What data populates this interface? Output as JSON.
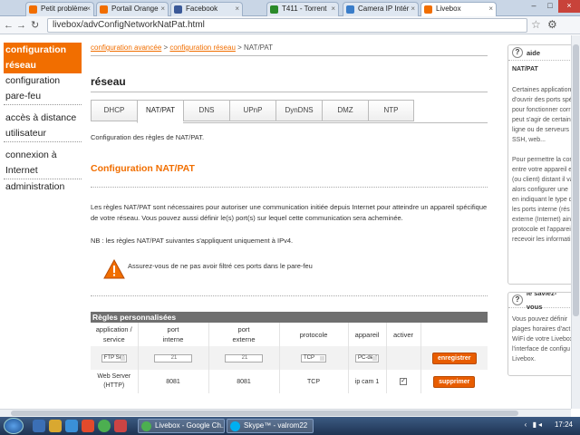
{
  "browser": {
    "tabs": [
      {
        "label": "Petit problème",
        "color": "#f16e00"
      },
      {
        "label": "Portail Orange",
        "color": "#f16e00"
      },
      {
        "label": "Facebook",
        "color": "#3b5998"
      },
      {
        "label": "T411 - Torrent",
        "color": "#2a8a2a"
      },
      {
        "label": "Camera IP Intér",
        "color": "#3a7dc9"
      },
      {
        "label": "Livebox",
        "color": "#f16e00"
      }
    ],
    "url": "livebox/advConfigNetworkNatPat.html"
  },
  "left_menu": {
    "items": [
      {
        "label": "configuration réseau",
        "active": true
      },
      {
        "label": "configuration pare-feu"
      },
      {
        "label": "accès à distance utilisateur"
      },
      {
        "label": "connexion à Internet"
      },
      {
        "label": "administration"
      }
    ]
  },
  "breadcrumb": {
    "part1": "configuration avancée",
    "sep1": " > ",
    "part2": "configuration réseau",
    "sep2": " > ",
    "current": "NAT/PAT"
  },
  "page": {
    "title": "réseau",
    "tabs": [
      "DHCP",
      "NAT/PAT",
      "DNS",
      "UPnP",
      "DynDNS",
      "DMZ",
      "NTP"
    ],
    "active_tab": "NAT/PAT",
    "description": "Configuration des règles de NAT/PAT.",
    "section_title": "Configuration NAT/PAT",
    "paragraph": "Les règles NAT/PAT sont nécessaires pour autoriser une communication initiée depuis Internet pour atteindre un appareil spécifique de votre réseau. Vous pouvez aussi définir le(s) port(s) sur lequel cette communication sera acheminée.",
    "note": "NB : les règles NAT/PAT suivantes s'appliquent uniquement à IPv4.",
    "warning": "Assurez-vous de ne pas avoir filtré ces ports dans le pare-feu"
  },
  "rules": {
    "title": "Règles personnalisées",
    "headers": {
      "app_line1": "application /",
      "app_line2": "service",
      "int_line1": "port",
      "int_line2": "interne",
      "ext_line1": "port",
      "ext_line2": "externe",
      "protocol": "protocole",
      "device": "appareil",
      "activate": "activer"
    },
    "new_row": {
      "app": "FTP Ser",
      "int_port": "21",
      "ext_port": "21",
      "protocol": "TCP",
      "device": "PC-de-r",
      "button": "enregistrer"
    },
    "existing_row": {
      "app_line1": "Web Server",
      "app_line2": "(HTTP)",
      "int_port": "8081",
      "ext_port": "8081",
      "protocol": "TCP",
      "device": "ip cam 1",
      "checked": "✓",
      "button": "supprimer"
    }
  },
  "aside": {
    "aide_title": "aide",
    "aide_subtitle": "NAT/PAT",
    "aide_lines": [
      "Certaines applications",
      "d'ouvrir des ports spé",
      "pour fonctionner corr",
      "peut s'agir de certain",
      "ligne ou de serveurs",
      "SSH, web...",
      "",
      "Pour permettre la con",
      "entre votre appareil e",
      "(ou client) distant il va",
      "alors configurer une",
      "en indiquant le type d",
      "les ports interne (rés",
      "externe (Internet) ain",
      "protocole et l'appareil",
      "recevoir les informati"
    ],
    "saviez_title": "le saviez-vous",
    "saviez_lines": [
      "Vous pouvez définir",
      "plages horaires d'act",
      "WiFi de votre Livebox",
      "l'interface de configu",
      "Livebox."
    ]
  },
  "taskbar": {
    "tasks": [
      "Livebox - Google Ch...",
      "Skype™ - valrom22"
    ],
    "clock": "17:24"
  }
}
